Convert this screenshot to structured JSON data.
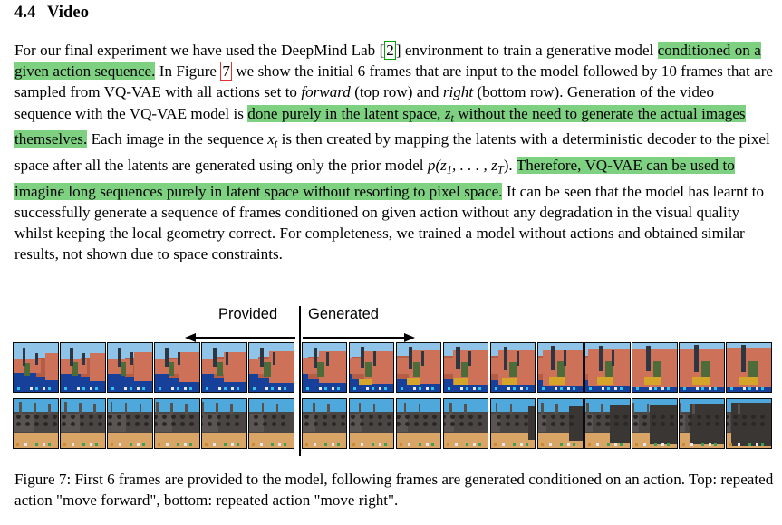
{
  "section": {
    "number": "4.4",
    "title": "Video"
  },
  "paragraph": {
    "run_1": "For our final experiment we have used the DeepMind Lab ",
    "cite_1": "2",
    "run_2": " environment to train a generative model ",
    "highlight_1": "conditioned on a given action sequence.",
    "run_3": " In Figure ",
    "ref_1": "7",
    "run_4": " we show the initial 6 frames that are input to the model followed by 10 frames that are sampled from VQ-VAE with all actions set to ",
    "italic_1": "forward",
    "run_5": " (top row) and ",
    "italic_2": "right",
    "run_6": " (bottom row). Generation of the video sequence with the VQ-VAE model is ",
    "highlight_2a": "done purely in the latent space, ",
    "math_z": "z",
    "math_z_sub": "t",
    "highlight_2b": " without the need to generate the actual images themselves.",
    "run_7": " Each image in the sequence ",
    "math_x": "x",
    "math_x_sub": "t",
    "run_8": " is then created by mapping the latents with a deterministic decoder to the pixel space after all the latents are generated using only the prior model ",
    "math_prior": "p(z",
    "math_prior_sub1": "1",
    "math_prior_mid": ", . . . , z",
    "math_prior_sub2": "T",
    "math_prior_end": ").",
    "highlight_3": "Therefore, VQ-VAE can be used to imagine long sequences purely in latent space without resorting to pixel space.",
    "run_9": " It can be seen that the model has learnt to successfully generate a sequence of frames conditioned on given action without any degradation in the visual quality whilst keeping the local geometry correct. For completeness, we trained a model without actions and obtained similar results, not shown due to space constraints."
  },
  "figure": {
    "label_provided": "Provided",
    "label_generated": "Generated",
    "provided_frame_count": 6,
    "generated_frame_count": 10,
    "rows": [
      {
        "name": "top-row",
        "action": "move forward"
      },
      {
        "name": "bottom-row",
        "action": "move right"
      }
    ],
    "highlight_color": "#7fd182",
    "cite_box_color": "#00a000",
    "ref_box_color": "#e03030"
  },
  "caption": {
    "label": "Figure 7:",
    "text": " First 6 frames are provided to the model, following frames are generated conditioned on an action. Top: repeated action \"move forward\", bottom: repeated action \"move right\"."
  }
}
